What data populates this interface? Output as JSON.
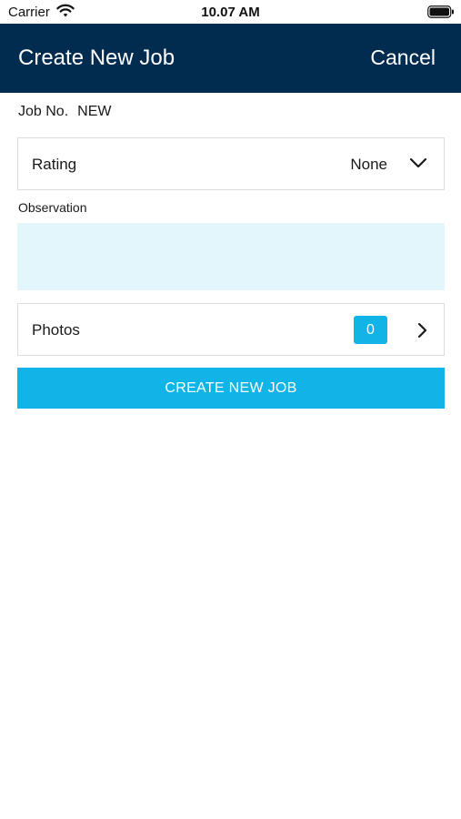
{
  "status_bar": {
    "carrier": "Carrier",
    "time": "10.07 AM",
    "wifi_icon": "wifi-icon",
    "battery_icon": "battery-icon"
  },
  "nav": {
    "title": "Create New Job",
    "cancel_label": "Cancel",
    "background_color": "#022c4f"
  },
  "job": {
    "label": "Job No.",
    "value": "NEW"
  },
  "rating": {
    "label": "Rating",
    "selected": "None",
    "icon": "chevron-down-icon"
  },
  "observation": {
    "label": "Observation",
    "value": "",
    "field_color": "#e3f6fb"
  },
  "photos": {
    "label": "Photos",
    "count": "0",
    "icon": "chevron-right-icon",
    "badge_color": "#10b4e6"
  },
  "actions": {
    "create_label": "CREATE NEW JOB",
    "button_color": "#10b4e6"
  }
}
